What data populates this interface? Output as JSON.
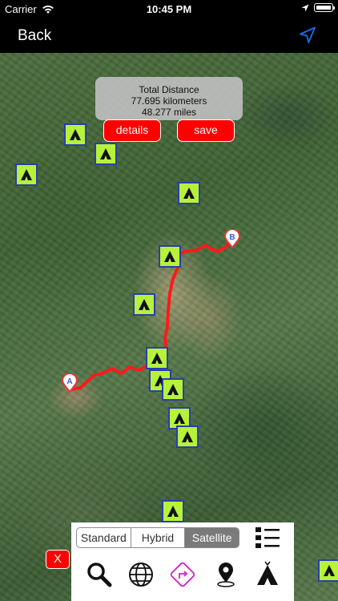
{
  "status_bar": {
    "carrier": "Carrier",
    "time": "10:45 PM"
  },
  "nav": {
    "back_label": "Back"
  },
  "distance": {
    "title": "Total Distance",
    "kilometers": "77.695 kilometers",
    "miles": "48.277 miles"
  },
  "buttons": {
    "details": "details",
    "save": "save",
    "clear": "X"
  },
  "pins": {
    "start": "A",
    "end": "B"
  },
  "map_type": {
    "options": [
      "Standard",
      "Hybrid",
      "Satellite"
    ],
    "selected": "Satellite"
  },
  "tools": [
    "search-icon",
    "globe-icon",
    "route-icon",
    "location-pin-icon",
    "tent-icon"
  ],
  "colors": {
    "route": "#ff1a1a",
    "campsite_fill": "#b6f23a",
    "campsite_border": "#2a3fa8",
    "button_red": "#ff0000",
    "accent_blue": "#1a6ef5",
    "route_tool_magenta": "#d020c8"
  },
  "campsite_count": 17
}
